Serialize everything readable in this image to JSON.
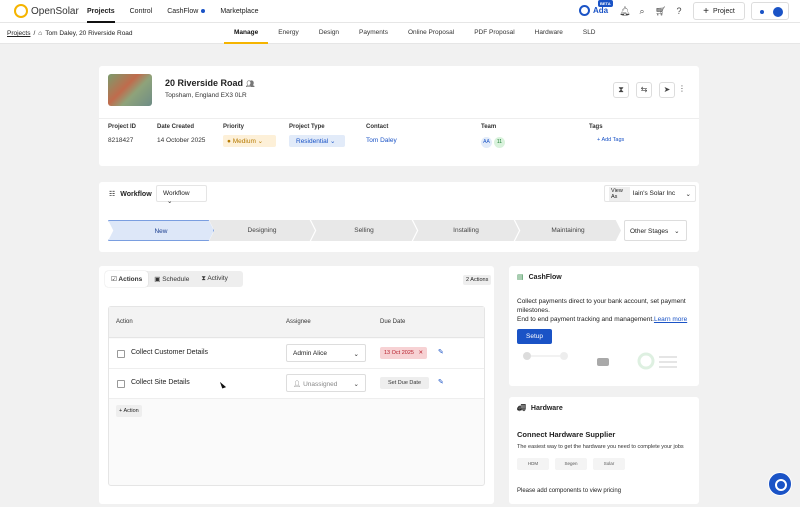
{
  "topnav": {
    "logo_text": "OpenSolar",
    "items": [
      "Projects",
      "Control",
      "CashFlow",
      "Marketplace"
    ],
    "ada_label": "Ada",
    "beta_label": "BETA",
    "project_button": "Project"
  },
  "subnav": {
    "breadcrumb_projects": "Projects",
    "breadcrumb_sep": "/",
    "breadcrumb_current": "Tom Daley, 20 Riverside Road",
    "tabs": [
      "Manage",
      "Energy",
      "Design",
      "Payments",
      "Online Proposal",
      "PDF Proposal",
      "Hardware",
      "SLD"
    ]
  },
  "project": {
    "address_line1": "20 Riverside Road",
    "address_line2": "Topsham, England EX3 0LR",
    "fields": {
      "id_label": "Project ID",
      "id_value": "8218427",
      "date_label": "Date Created",
      "date_value": "14 October 2025",
      "priority_label": "Priority",
      "priority_value": "Medium",
      "type_label": "Project Type",
      "type_value": "Residential",
      "contact_label": "Contact",
      "contact_value": "Tom Daley",
      "team_label": "Team",
      "team_member1": "AA",
      "team_member2": "11",
      "tags_label": "Tags",
      "add_tags": "Add Tags"
    }
  },
  "workflow": {
    "title": "Workflow",
    "selected": "Workflow",
    "view_as_label": "View As",
    "view_as_value": "Iain's Solar Inc",
    "stages": [
      "New",
      "Designing",
      "Selling",
      "Installing",
      "Maintaining"
    ],
    "other_stages": "Other Stages"
  },
  "actions": {
    "tabs": [
      "Actions",
      "Schedule",
      "Activity"
    ],
    "count": "2 Actions",
    "columns": [
      "Action",
      "Assignee",
      "Due Date"
    ],
    "rows": [
      {
        "name": "Collect Customer Details",
        "assignee": "Admin Alice",
        "due": "13 Oct 2025"
      },
      {
        "name": "Collect Site Details",
        "assignee": "Unassigned",
        "due": "Set Due Date"
      }
    ],
    "add_label": "Action"
  },
  "cashflow": {
    "title": "CashFlow",
    "text1": "Collect payments direct to your bank account, set payment milestones.",
    "text2": "End to end payment tracking and management.",
    "learn_more": "Learn more",
    "setup": "Setup"
  },
  "hardware": {
    "title": "Hardware",
    "heading": "Connect Hardware Supplier",
    "sub": "The easiest way to get the hardware you need to complete your jobs",
    "logos": [
      "HDM",
      "Segen",
      "Solar"
    ],
    "note": "Please add components to view pricing"
  },
  "colors": {
    "accent": "#1a53c6",
    "brand": "#f5b400",
    "stage_active": "#dde7f8"
  }
}
